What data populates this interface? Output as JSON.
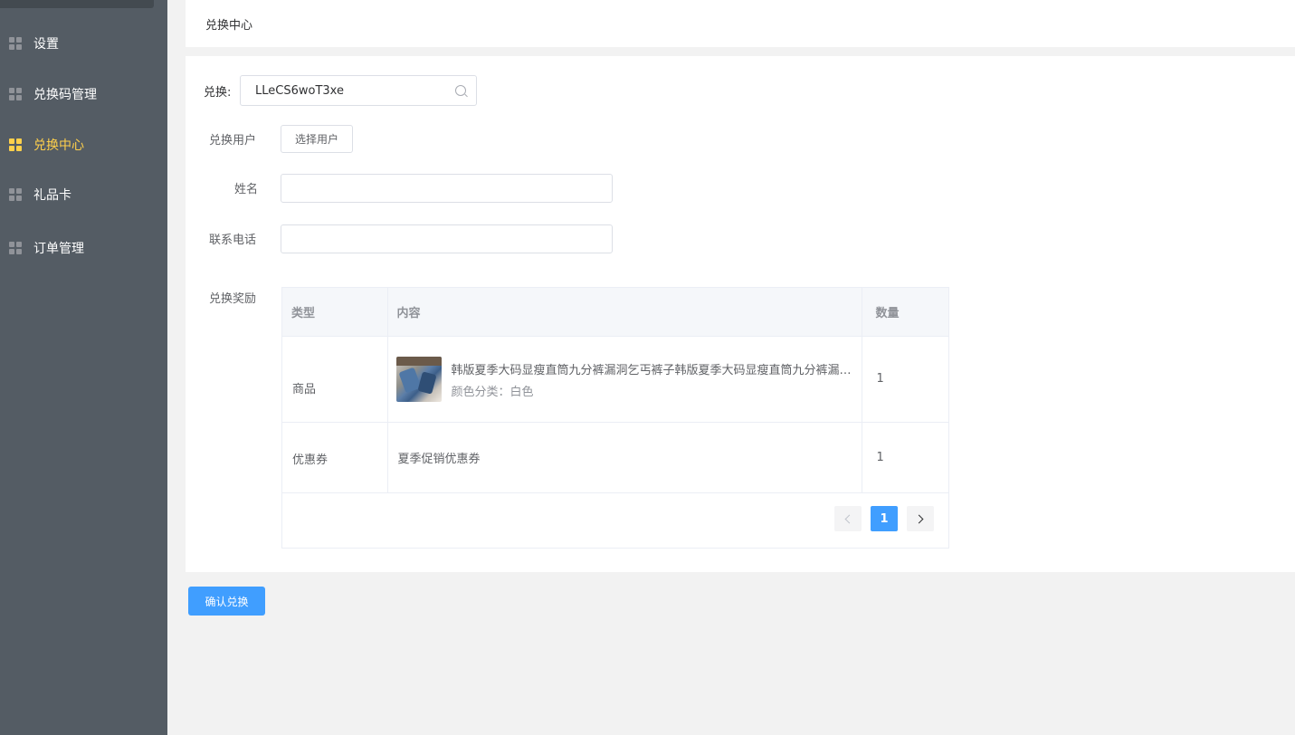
{
  "sidebar": {
    "items": [
      {
        "label": "设置",
        "active": false
      },
      {
        "label": "兑换码管理",
        "active": false
      },
      {
        "label": "兑换中心",
        "active": true
      },
      {
        "label": "礼品卡",
        "active": false
      },
      {
        "label": "订单管理",
        "active": false
      }
    ],
    "icon": "grid-icon",
    "bg_color": "#545c64",
    "active_color": "#ffd04b"
  },
  "header": {
    "title": "兑换中心"
  },
  "form": {
    "redeem_label": "兑换:",
    "redeem_code": "LLeCS6woT3xe",
    "user_label": "兑换用户",
    "select_user_label": "选择用户",
    "name_label": "姓名",
    "name_value": "",
    "phone_label": "联系电话",
    "phone_value": "",
    "reward_label": "兑换奖励"
  },
  "table": {
    "columns": [
      "类型",
      "内容",
      "数量"
    ],
    "rows": [
      {
        "type": "商品",
        "name": "韩版夏季大码显瘦直筒九分裤漏洞乞丐裤子韩版夏季大码显瘦直筒九分裤漏洞乞丐裤子",
        "spec": "颜色分类：白色",
        "qty": "1"
      },
      {
        "type": "优惠券",
        "name": "夏季促销优惠券",
        "qty": "1"
      }
    ]
  },
  "pagination": {
    "current": "1"
  },
  "confirm_label": "确认兑换",
  "primary_color": "#409eff"
}
